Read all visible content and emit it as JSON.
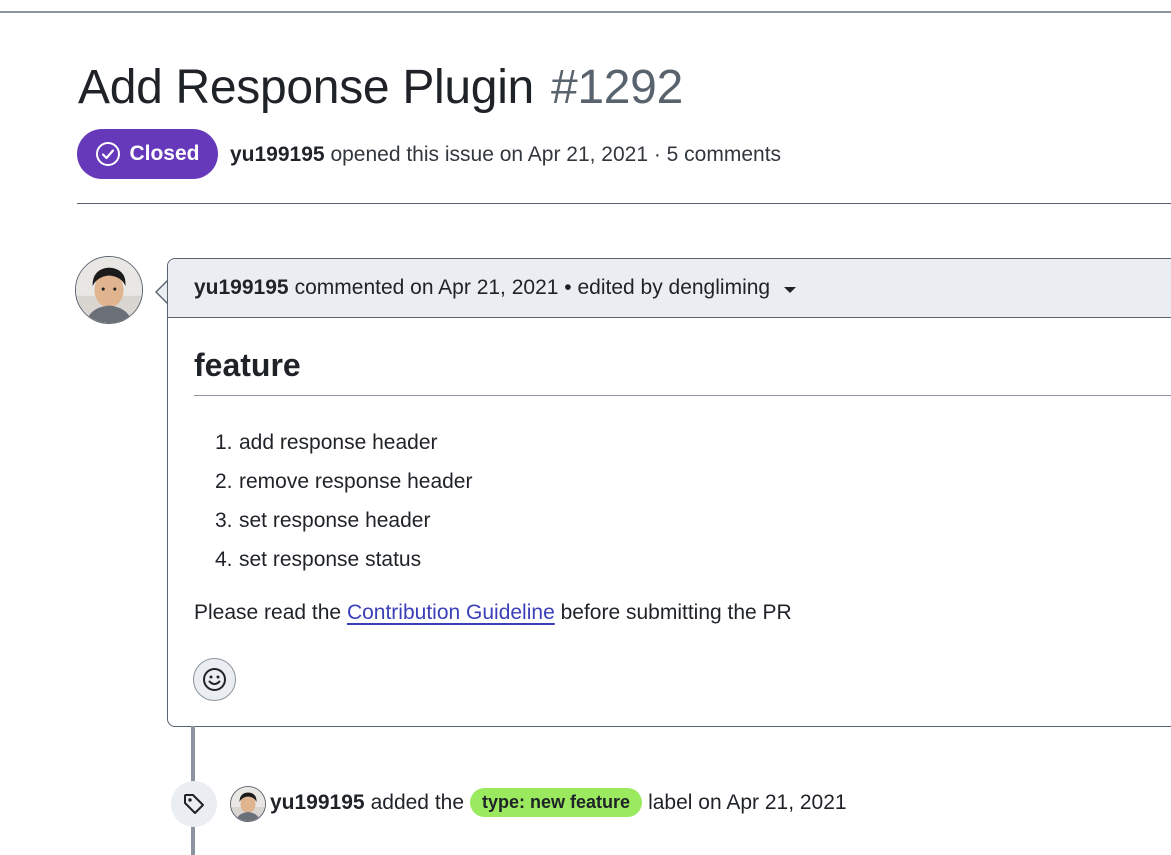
{
  "issue": {
    "title": "Add Response Plugin",
    "number": "#1292",
    "state": "Closed",
    "state_color": "#6639ba",
    "author": "yu199195",
    "opened_text": "opened this issue on Apr 21, 2021 · 5 comments"
  },
  "comment": {
    "author": "yu199195",
    "header_text": "commented on Apr 21, 2021 • edited by dengliming",
    "heading": "feature",
    "steps": [
      {
        "n": "1.",
        "text": "add response header"
      },
      {
        "n": "2.",
        "text": "remove response header"
      },
      {
        "n": "3.",
        "text": "set response header"
      },
      {
        "n": "4.",
        "text": "set response status"
      }
    ],
    "note_before": "Please read the",
    "note_link": "Contribution Guideline",
    "note_after": "before submitting the PR",
    "reaction_icon": "smiley-icon"
  },
  "event": {
    "author": "yu199195",
    "action": "added the",
    "label": "type: new feature",
    "label_color": "#9be95f",
    "suffix": "label on Apr 21, 2021",
    "icon": "tag-icon"
  }
}
